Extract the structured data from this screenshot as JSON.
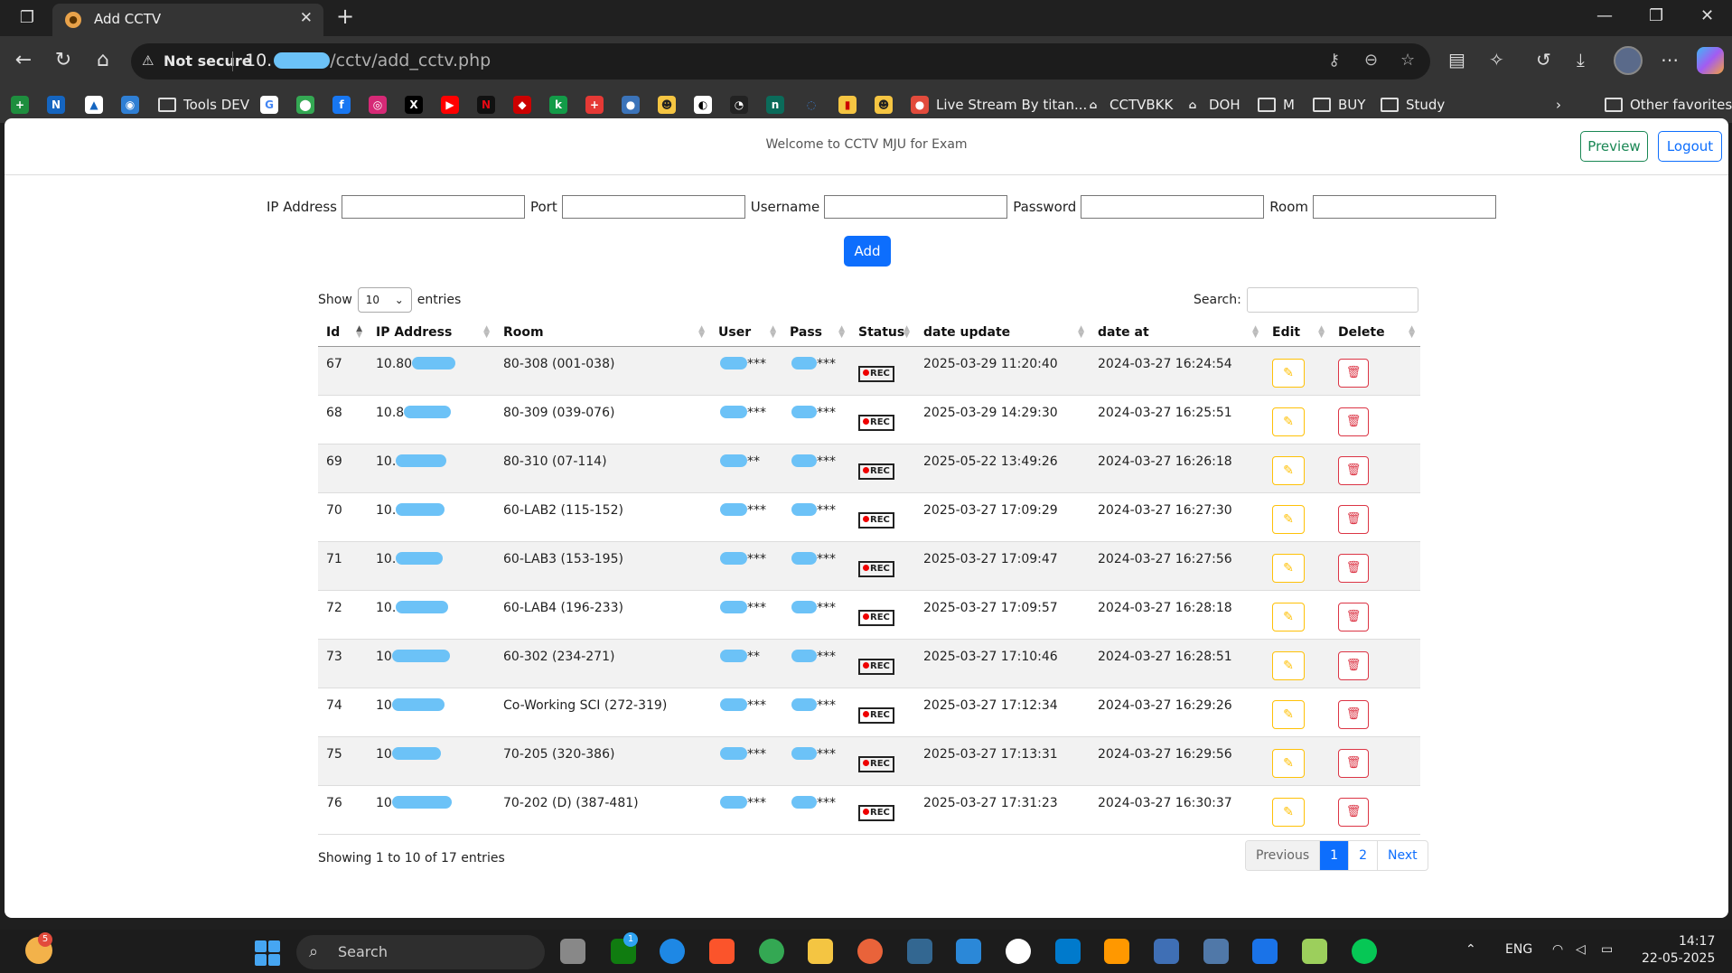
{
  "browser": {
    "tab_title": "Add CCTV",
    "security_label": "Not secure",
    "url_prefix": "10.",
    "url_path": "/cctv/add_cctv.php"
  },
  "favorites": {
    "items": [
      "Tools DEV",
      "Live Stream By titan...",
      "CCTVBKK",
      "DOH",
      "M",
      "BUY",
      "Study"
    ],
    "other": "Other favorites"
  },
  "header": {
    "welcome": "Welcome to CCTV MJU for Exam",
    "preview": "Preview",
    "logout": "Logout"
  },
  "form": {
    "ip_label": "IP Address",
    "port_label": "Port",
    "username_label": "Username",
    "password_label": "Password",
    "room_label": "Room",
    "add_button": "Add"
  },
  "table_controls": {
    "show": "Show",
    "entries_value": "10",
    "entries": "entries",
    "search": "Search:",
    "info": "Showing 1 to 10 of 17 entries"
  },
  "columns": [
    "Id",
    "IP Address",
    "Room",
    "User",
    "Pass",
    "Status",
    "date update",
    "date at",
    "Edit",
    "Delete"
  ],
  "rows": [
    {
      "id": "67",
      "ip": "10.80",
      "room": "80-308 (001-038)",
      "user": "***",
      "pass": "***",
      "status": "REC",
      "date_update": "2025-03-29 11:20:40",
      "date_at": "2024-03-27 16:24:54"
    },
    {
      "id": "68",
      "ip": "10.8",
      "room": "80-309 (039-076)",
      "user": "***",
      "pass": "***",
      "status": "REC",
      "date_update": "2025-03-29 14:29:30",
      "date_at": "2024-03-27 16:25:51"
    },
    {
      "id": "69",
      "ip": "10.",
      "room": "80-310 (07-114)",
      "user": "**",
      "pass": "***",
      "status": "REC",
      "date_update": "2025-05-22 13:49:26",
      "date_at": "2024-03-27 16:26:18"
    },
    {
      "id": "70",
      "ip": "10.",
      "room": "60-LAB2 (115-152)",
      "user": "***",
      "pass": "***",
      "status": "REC",
      "date_update": "2025-03-27 17:09:29",
      "date_at": "2024-03-27 16:27:30"
    },
    {
      "id": "71",
      "ip": "10.",
      "room": "60-LAB3 (153-195)",
      "user": "***",
      "pass": "***",
      "status": "REC",
      "date_update": "2025-03-27 17:09:47",
      "date_at": "2024-03-27 16:27:56"
    },
    {
      "id": "72",
      "ip": "10.",
      "room": "60-LAB4 (196-233)",
      "user": "***",
      "pass": "***",
      "status": "REC",
      "date_update": "2025-03-27 17:09:57",
      "date_at": "2024-03-27 16:28:18"
    },
    {
      "id": "73",
      "ip": "10",
      "room": "60-302 (234-271)",
      "user": "**",
      "pass": "***",
      "status": "REC",
      "date_update": "2025-03-27 17:10:46",
      "date_at": "2024-03-27 16:28:51"
    },
    {
      "id": "74",
      "ip": "10",
      "room": "Co-Working SCI (272-319)",
      "user": "***",
      "pass": "***",
      "status": "REC",
      "date_update": "2025-03-27 17:12:34",
      "date_at": "2024-03-27 16:29:26"
    },
    {
      "id": "75",
      "ip": "10",
      "room": "70-205 (320-386)",
      "user": "***",
      "pass": "***",
      "status": "REC",
      "date_update": "2025-03-27 17:13:31",
      "date_at": "2024-03-27 16:29:56"
    },
    {
      "id": "76",
      "ip": "10",
      "room": "70-202 (D) (387-481)",
      "user": "***",
      "pass": "***",
      "status": "REC",
      "date_update": "2025-03-27 17:31:23",
      "date_at": "2024-03-27 16:30:37"
    }
  ],
  "pagination": {
    "previous": "Previous",
    "pages": [
      "1",
      "2"
    ],
    "next": "Next"
  },
  "taskbar": {
    "weather_badge": "5",
    "search": "Search",
    "app_badge": "1",
    "lang": "ENG",
    "time": "14:17",
    "date": "22-05-2025"
  },
  "colors": {
    "primary": "#0d6efd",
    "success": "#198754",
    "warning": "#ffc107",
    "danger": "#dc3545",
    "mask": "#6cc2f7"
  }
}
